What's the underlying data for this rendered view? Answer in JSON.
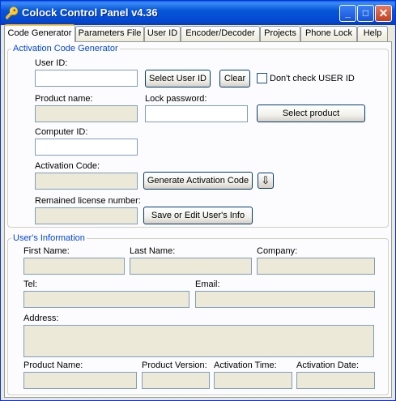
{
  "window": {
    "title": "Colock Control Panel v4.36",
    "minimize": "_",
    "maximize": "□",
    "close": "✕"
  },
  "tabs": [
    "Code Generator",
    "Parameters File",
    "User ID",
    "Encoder/Decoder",
    "Projects",
    "Phone Lock",
    "Help"
  ],
  "activation": {
    "group_title": "Activation Code Generator",
    "user_id_label": "User ID:",
    "user_id_value": "",
    "select_user_id": "Select User ID",
    "clear": "Clear",
    "dont_check": "Don't check USER ID",
    "product_name_label": "Product name:",
    "product_name_value": "",
    "lock_password_label": "Lock password:",
    "lock_password_value": "",
    "select_product": "Select product",
    "computer_id_label": "Computer ID:",
    "computer_id_value": "",
    "activation_code_label": "Activation Code:",
    "activation_code_value": "",
    "generate": "Generate Activation Code",
    "down_arrow": "⇩",
    "remained_label": "Remained license number:",
    "remained_value": "",
    "save_edit": "Save or Edit User's Info"
  },
  "user_info": {
    "group_title": "User's Information",
    "first_name_label": "First Name:",
    "last_name_label": "Last Name:",
    "company_label": "Company:",
    "tel_label": "Tel:",
    "email_label": "Email:",
    "address_label": "Address:",
    "product_name_label": "Product Name:",
    "product_version_label": "Product Version:",
    "activation_time_label": "Activation Time:",
    "activation_date_label": "Activation Date:"
  },
  "icons": {
    "app": "app-key-icon",
    "down": "down-arrow-icon"
  }
}
